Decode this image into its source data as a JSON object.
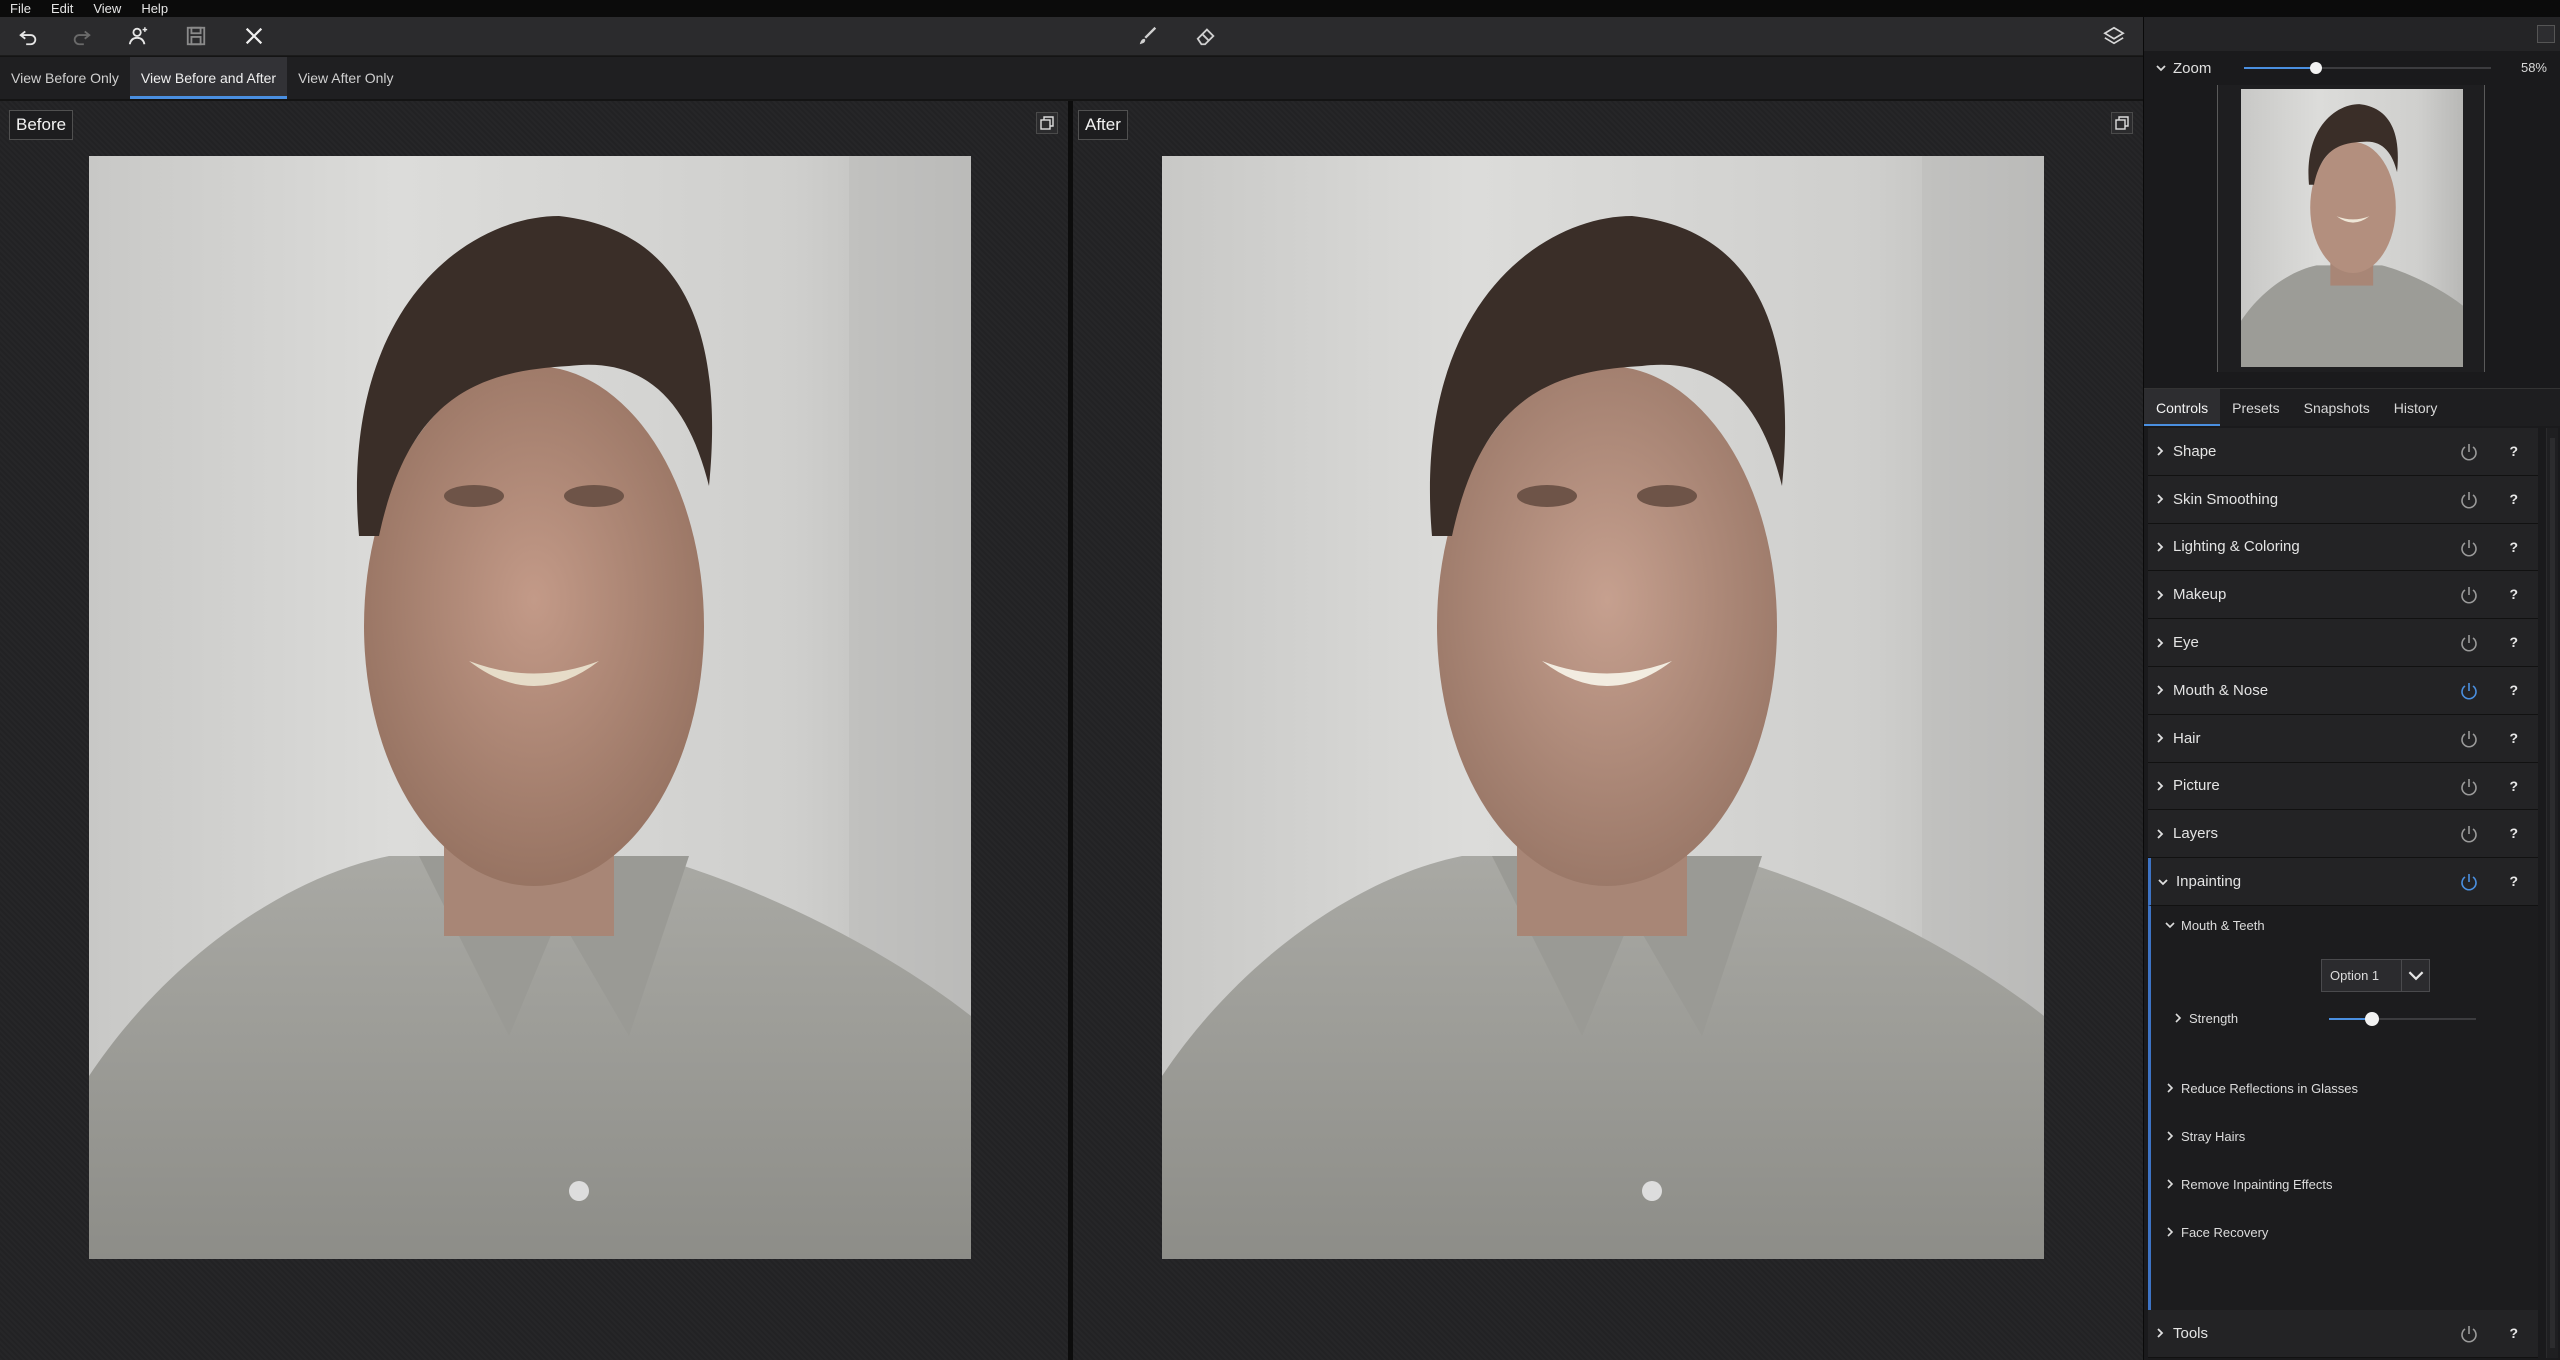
{
  "menu": [
    "File",
    "Edit",
    "View",
    "Help"
  ],
  "toolbar": {
    "icons": [
      "undo-icon",
      "redo-icon",
      "face-select-icon",
      "save-icon",
      "close-icon",
      "brush-icon",
      "eraser-icon",
      "layers-icon"
    ]
  },
  "view_tabs": [
    {
      "label": "View Before Only",
      "active": false
    },
    {
      "label": "View Before and After",
      "active": true
    },
    {
      "label": "View After Only",
      "active": false
    }
  ],
  "panes": {
    "before_label": "Before",
    "after_label": "After"
  },
  "zoom": {
    "label": "Zoom",
    "value": "58%",
    "slider_fraction": 0.29
  },
  "control_tabs": [
    {
      "label": "Controls",
      "active": true
    },
    {
      "label": "Presets",
      "active": false
    },
    {
      "label": "Snapshots",
      "active": false
    },
    {
      "label": "History",
      "active": false
    }
  ],
  "sections": [
    {
      "label": "Shape",
      "enabled": false,
      "help": "?"
    },
    {
      "label": "Skin Smoothing",
      "enabled": false,
      "help": "?"
    },
    {
      "label": "Lighting & Coloring",
      "enabled": false,
      "help": "?"
    },
    {
      "label": "Makeup",
      "enabled": false,
      "help": "?"
    },
    {
      "label": "Eye",
      "enabled": false,
      "help": "?"
    },
    {
      "label": "Mouth & Nose",
      "enabled": true,
      "help": "?"
    },
    {
      "label": "Hair",
      "enabled": false,
      "help": "?"
    },
    {
      "label": "Picture",
      "enabled": false,
      "help": "?"
    },
    {
      "label": "Layers",
      "enabled": false,
      "help": "?"
    },
    {
      "label": "Inpainting",
      "enabled": true,
      "help": "?",
      "expanded": true
    }
  ],
  "inpainting": {
    "mouth_teeth": "Mouth & Teeth",
    "option_value": "Option 1",
    "strength_label": "Strength",
    "strength_fraction": 0.29,
    "subsections": [
      "Reduce Reflections in Glasses",
      "Stray Hairs",
      "Remove Inpainting Effects",
      "Face Recovery"
    ]
  },
  "tools": {
    "label": "Tools",
    "enabled": false,
    "help": "?"
  },
  "colors": {
    "accent": "#4a8fe0",
    "power_on": "#4a8fe0",
    "power_off": "#9a9a9a"
  }
}
